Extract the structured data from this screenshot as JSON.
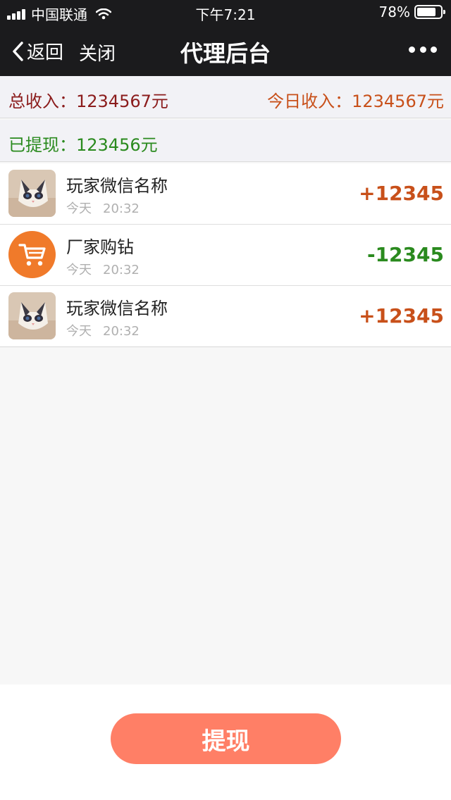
{
  "status_bar": {
    "carrier": "中国联通",
    "time": "下午7:21",
    "battery": "78%",
    "battery_level": 0.78
  },
  "navbar": {
    "back_label": "返回",
    "close_label": "关闭",
    "title": "代理后台"
  },
  "summary": {
    "total_income": "总收入：1234567元",
    "today_income": "今日收入：1234567元",
    "withdrawn": "已提现：123456元"
  },
  "transactions": [
    {
      "name": "玩家微信名称",
      "day": "今天",
      "time": "20:32",
      "amount": "+12345",
      "avatar": "cat-avatar",
      "type": "income"
    },
    {
      "name": "厂家购钻",
      "day": "今天",
      "time": "20:32",
      "amount": "-12345",
      "avatar": "cart-icon",
      "type": "expense"
    },
    {
      "name": "玩家微信名称",
      "day": "今天",
      "time": "20:32",
      "amount": "+12345",
      "avatar": "cat-avatar",
      "type": "income"
    }
  ],
  "colors": {
    "income": "#c8501a",
    "expense": "#2a8a1e",
    "total": "#8b1c1c",
    "button": "#ff7f66",
    "cart_bg": "#f07a2a"
  },
  "actions": {
    "withdraw_label": "提现"
  }
}
